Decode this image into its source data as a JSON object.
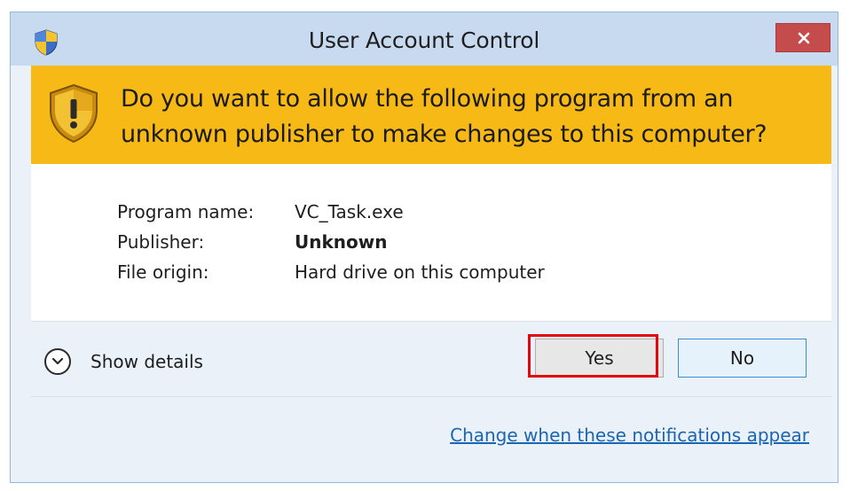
{
  "window": {
    "title": "User Account Control",
    "title_icon": "uac-shield-icon",
    "close_icon": "close-icon"
  },
  "banner": {
    "icon": "warning-shield-icon",
    "question": "Do you want to allow the following program from an unknown publisher to make changes to this computer?",
    "background": "#f6b915"
  },
  "details": {
    "rows": [
      {
        "label": "Program name:",
        "value": "VC_Task.exe",
        "bold": false
      },
      {
        "label": "Publisher:",
        "value": "Unknown",
        "bold": true
      },
      {
        "label": "File origin:",
        "value": "Hard drive on this computer",
        "bold": false
      }
    ]
  },
  "footer": {
    "show_details_label": "Show details",
    "show_details_icon": "chevron-down-circle-icon",
    "yes_label": "Yes",
    "no_label": "No",
    "notifications_link": "Change when these notifications appear",
    "highlight_color": "#e3060c"
  }
}
